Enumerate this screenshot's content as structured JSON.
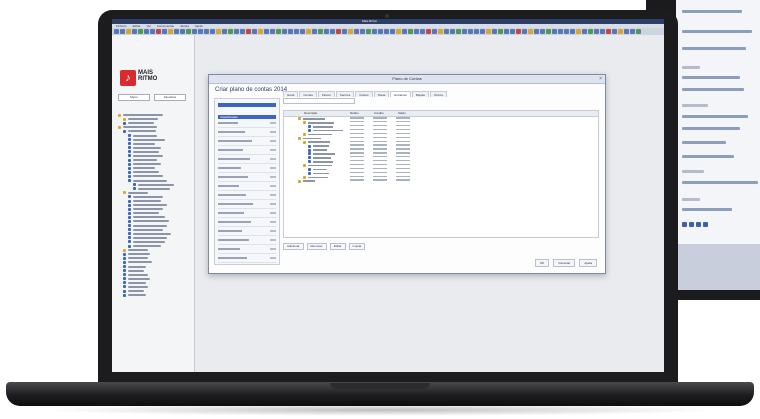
{
  "app": {
    "title": "Mais Ritmo",
    "logo_letter": "♪",
    "logo_lines": [
      "MAIS",
      "RITMO"
    ],
    "menu": [
      "Ficheiro",
      "Editar",
      "Ver",
      "Ferramentas",
      "Janela",
      "Ajuda"
    ]
  },
  "left_pane": {
    "tabs": [
      "Menu",
      "Favoritos"
    ]
  },
  "dialog": {
    "title": "Plano de Contas",
    "heading": "Criar plano de contas 2014",
    "filter_header": "Classificação",
    "tabs": [
      "Geral",
      "Contas",
      "Fluxos",
      "Centros",
      "Custos",
      "Taxas",
      "Extractos",
      "Mapas",
      "Outros"
    ],
    "grid_headers": [
      "Descrição",
      "Débito",
      "Crédito",
      "Saldo"
    ],
    "bottom_buttons": [
      "Adicionar",
      "Remover",
      "Editar",
      "Copiar"
    ],
    "footer_buttons": [
      "OK",
      "Cancelar",
      "Ajuda"
    ],
    "close_symbol": "×"
  },
  "colors": {
    "brand_red": "#d92b2f",
    "accent_blue": "#3d63c6",
    "titlebar": "#2c3e66"
  }
}
